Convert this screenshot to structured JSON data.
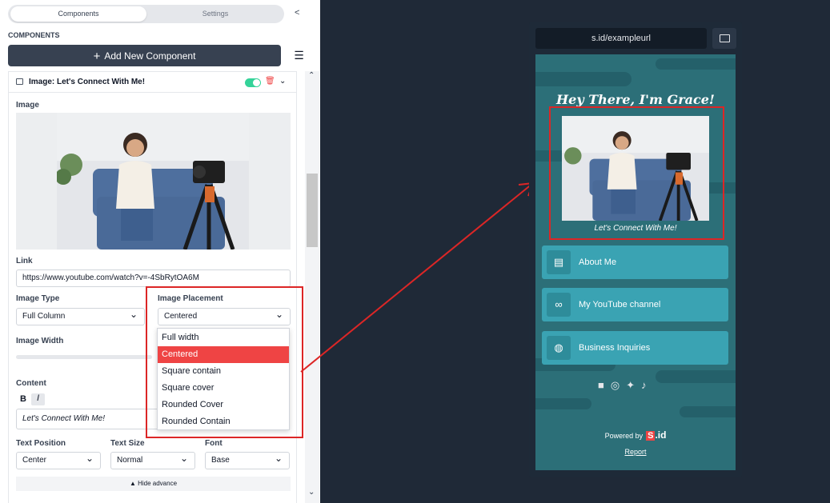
{
  "tabs": [
    {
      "label": "Components"
    },
    {
      "label": "Settings"
    }
  ],
  "section_title": "COMPONENTS",
  "add_button": {
    "label": "Add New Component"
  },
  "component": {
    "title": "Image: Let's Connect With Me!",
    "enabled": true,
    "image_label": "Image",
    "link_label": "Link",
    "link_value": "https://www.youtube.com/watch?v=-4SbRytOA6M",
    "image_type_label": "Image Type",
    "image_type_value": "Full Column",
    "image_placement_label": "Image Placement",
    "image_placement_value": "Centered",
    "placement_options": [
      "Full width",
      "Centered",
      "Square contain",
      "Square cover",
      "Rounded Cover",
      "Rounded Contain"
    ],
    "image_width_label": "Image Width",
    "content_label": "Content",
    "bold_label": "B",
    "italic_label": "I",
    "content_value": "Let's Connect With Me!",
    "text_position_label": "Text Position",
    "text_position_value": "Center",
    "text_size_label": "Text Size",
    "text_size_value": "Normal",
    "font_label": "Font",
    "font_value": "Base",
    "hide_advance_label": "Hide advance"
  },
  "preview": {
    "url": "s.id/exampleurl",
    "heading": "Hey There, I'm Grace!",
    "caption": "Let's Connect With Me!",
    "links": [
      {
        "label": "About Me",
        "icon": "id-card-icon"
      },
      {
        "label": "My YouTube channel",
        "icon": "link-icon"
      },
      {
        "label": "Business Inquiries",
        "icon": "globe-icon"
      }
    ],
    "social_icons": [
      "facebook-icon",
      "instagram-icon",
      "twitter-icon",
      "tiktok-icon"
    ],
    "powered_by": "Powered by",
    "brand_s": "S",
    "brand_id": ".id",
    "report": "Report"
  },
  "colors": {
    "accent": "#ef4444",
    "annotation": "#dc2626",
    "toggle": "#34d399",
    "phone_bg": "#2c6f78",
    "link_btn": "#3aa3b3"
  }
}
